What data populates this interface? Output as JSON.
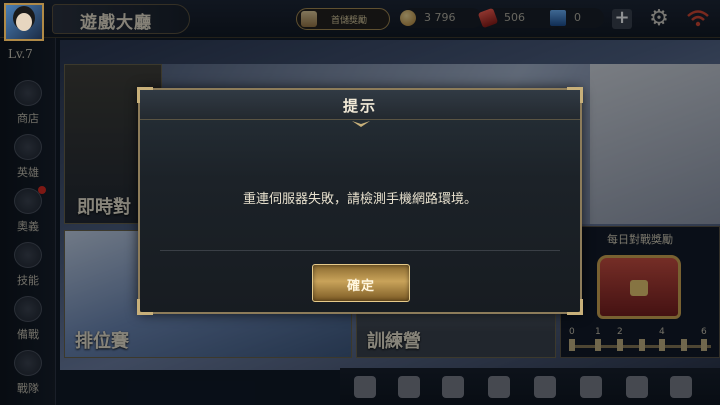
{
  "topbar": {
    "title": "遊戲大廳",
    "first_pay_label": "首儲獎勵",
    "gold": "3 796",
    "voucher": "506",
    "diamond": "0",
    "plus_symbol": "+",
    "gear_symbol": "⚙"
  },
  "player": {
    "level": "Lv.7"
  },
  "sidebar": {
    "items": [
      {
        "label": "商店",
        "icon": "cart-icon"
      },
      {
        "label": "英雄",
        "icon": "helmet-icon"
      },
      {
        "label": "奧義",
        "icon": "emblem-icon",
        "badge": true
      },
      {
        "label": "技能",
        "icon": "flame-icon"
      },
      {
        "label": "備戰",
        "icon": "armor-icon"
      },
      {
        "label": "戰隊",
        "icon": "team-icon"
      }
    ]
  },
  "tiles": {
    "realtime": "即時對",
    "rank": "排位賽",
    "training": "訓練營",
    "daily_reward": "每日對戰獎勵",
    "daily_ticks": [
      "0",
      "1",
      "2",
      "4",
      "6"
    ]
  },
  "bottombar": {
    "icons": [
      "chat-icon",
      "gift-icon",
      "backpack-icon",
      "friends-icon",
      "trophy-icon",
      "mail-icon",
      "social-icon",
      "record-icon"
    ]
  },
  "dialog": {
    "title": "提示",
    "message": "重連伺服器失敗，請檢測手機網路環境。",
    "confirm_label": "確定"
  }
}
